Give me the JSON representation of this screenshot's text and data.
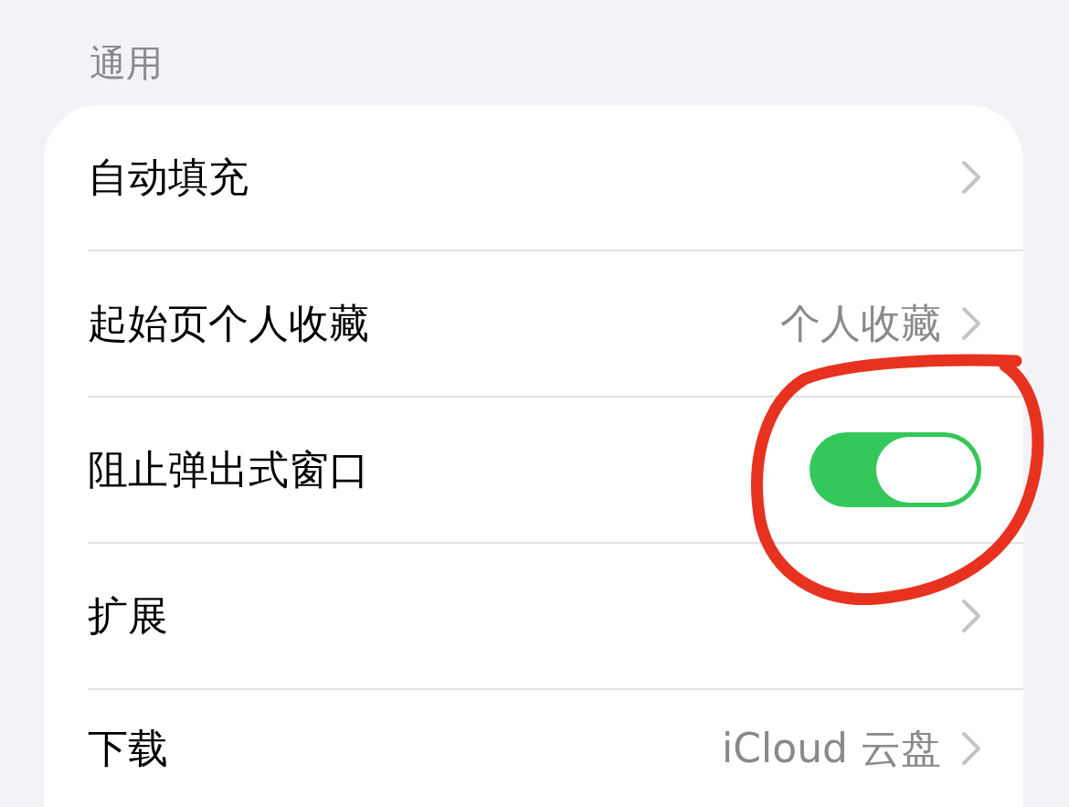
{
  "section": {
    "title": "通用",
    "rows": [
      {
        "kind": "link",
        "label": "自动填充"
      },
      {
        "kind": "link",
        "label": "起始页个人收藏",
        "value": "个人收藏"
      },
      {
        "kind": "toggle",
        "label": "阻止弹出式窗口",
        "on": true
      },
      {
        "kind": "link",
        "label": "扩展"
      },
      {
        "kind": "link",
        "label": "下载",
        "value": "iCloud 云盘"
      }
    ]
  }
}
